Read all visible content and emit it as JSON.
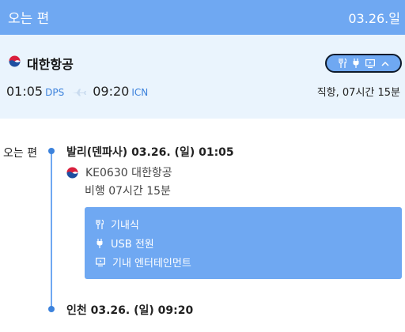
{
  "header": {
    "title": "오는 편",
    "date": "03.26.일"
  },
  "summary": {
    "airline": "대한항공",
    "departure_time": "01:05",
    "departure_code": "DPS",
    "arrival_time": "09:20",
    "arrival_code": "ICN",
    "duration": "직항, 07시간 15분",
    "amenity_icons": [
      "meal-icon",
      "power-plug-icon",
      "screen-icon",
      "chevron-up-icon"
    ]
  },
  "timeline": {
    "label": "오는 편",
    "departure": "발리(덴파사) 03.26. (일) 01:05",
    "flight": "KE0630 대한항공",
    "flight_duration": "비행 07시간 15분",
    "amenities": [
      {
        "icon": "meal-icon",
        "label": "기내식"
      },
      {
        "icon": "power-plug-icon",
        "label": "USB 전원"
      },
      {
        "icon": "screen-icon",
        "label": "기내 엔터테인먼트"
      }
    ],
    "arrival": "인천 03.26. (일) 09:20"
  },
  "colors": {
    "header_bg": "#6fa8f2",
    "card_bg": "#eaf4fd",
    "accent": "#3c82dc",
    "brand_red": "#d91f3d",
    "brand_blue": "#1e4fa1"
  }
}
